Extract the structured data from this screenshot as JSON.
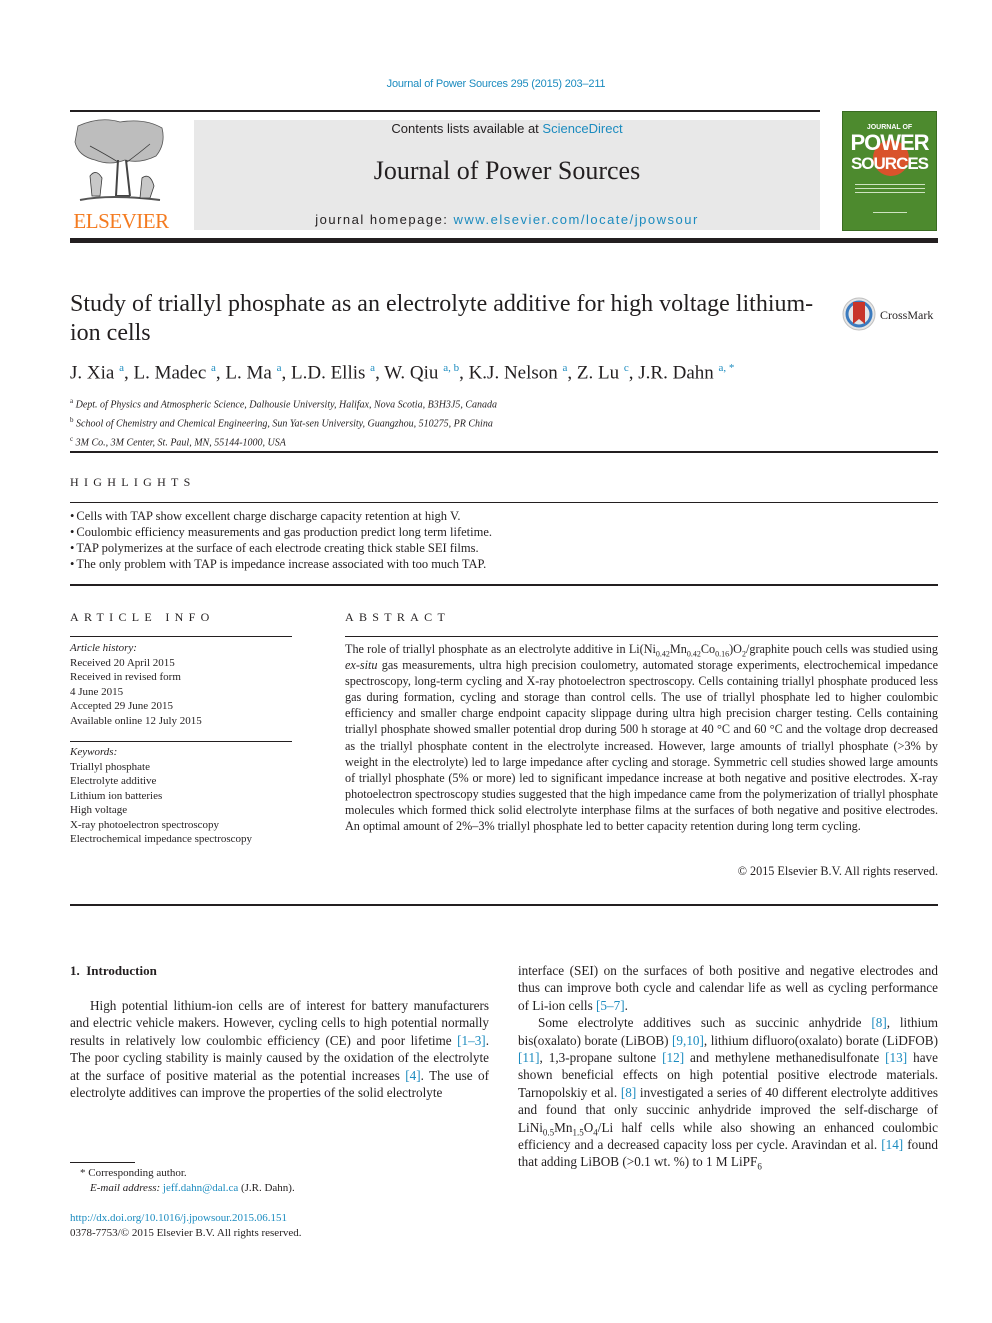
{
  "running_head": "Journal of Power Sources 295 (2015) 203–211",
  "masthead": {
    "publisher_logo_text": "ELSEVIER",
    "contents_prefix": "Contents lists available at ",
    "contents_link": "ScienceDirect",
    "journal_name": "Journal of Power Sources",
    "homepage_prefix": "journal homepage: ",
    "homepage_link": "www.elsevier.com/locate/jpowsour",
    "cover": {
      "line1": "JOURNAL OF",
      "line2": "POWER",
      "line3": "SOURCES"
    },
    "colors": {
      "link": "#1b8bbf",
      "elsevier_orange": "#f47b20",
      "cover_green": "#4d8a2e",
      "masthead_gray": "#e8e8e8"
    }
  },
  "article": {
    "title": "Study of triallyl phosphate as an electrolyte additive for high voltage lithium-ion cells",
    "crossmark_label": "CrossMark",
    "authors": [
      {
        "name": "J. Xia",
        "aff": "a"
      },
      {
        "name": "L. Madec",
        "aff": "a"
      },
      {
        "name": "L. Ma",
        "aff": "a"
      },
      {
        "name": "L.D. Ellis",
        "aff": "a"
      },
      {
        "name": "W. Qiu",
        "aff": "a, b"
      },
      {
        "name": "K.J. Nelson",
        "aff": "a"
      },
      {
        "name": "Z. Lu",
        "aff": "c"
      },
      {
        "name": "J.R. Dahn",
        "aff": "a, *"
      }
    ],
    "affiliations": [
      {
        "key": "a",
        "text": "Dept. of Physics and Atmospheric Science, Dalhousie University, Halifax, Nova Scotia, B3H3J5, Canada"
      },
      {
        "key": "b",
        "text": "School of Chemistry and Chemical Engineering, Sun Yat-sen University, Guangzhou, 510275, PR China"
      },
      {
        "key": "c",
        "text": "3M Co., 3M Center, St. Paul, MN, 55144-1000, USA"
      }
    ]
  },
  "highlights": {
    "label": "HIGHLIGHTS",
    "items": [
      "Cells with TAP show excellent charge discharge capacity retention at high V.",
      "Coulombic efficiency measurements and gas production predict long term lifetime.",
      "TAP polymerizes at the surface of each electrode creating thick stable SEI films.",
      "The only problem with TAP is impedance increase associated with too much TAP."
    ]
  },
  "article_info": {
    "label": "ARTICLE INFO",
    "history_label": "Article history:",
    "history": [
      "Received 20 April 2015",
      "Received in revised form",
      "4 June 2015",
      "Accepted 29 June 2015",
      "Available online 12 July 2015"
    ],
    "keywords_label": "Keywords:",
    "keywords": [
      "Triallyl phosphate",
      "Electrolyte additive",
      "Lithium ion batteries",
      "High voltage",
      "X-ray photoelectron spectroscopy",
      "Electrochemical impedance spectroscopy"
    ]
  },
  "abstract": {
    "label": "ABSTRACT",
    "p1": "The role of triallyl phosphate as an electrolyte additive in Li(Ni",
    "s1": "0.42",
    "p2": "Mn",
    "s2": "0.42",
    "p3": "Co",
    "s3": "0.16",
    "p4": ")O",
    "s4": "2",
    "p5": "/graphite pouch cells was studied using ",
    "ital": "ex-situ",
    "p6": " gas measurements, ultra high precision coulometry, automated storage experiments, electrochemical impedance spectroscopy, long-term cycling and X-ray photoelectron spectroscopy. Cells containing triallyl phosphate produced less gas during formation, cycling and storage than control cells. The use of triallyl phosphate led to higher coulombic efficiency and smaller charge endpoint capacity slippage during ultra high precision charger testing. Cells containing triallyl phosphate showed smaller potential drop during 500 h storage at 40 °C and 60 °C and the voltage drop decreased as the triallyl phosphate content in the electrolyte increased. However, large amounts of triallyl phosphate (>3% by weight in the electrolyte) led to large impedance after cycling and storage. Symmetric cell studies showed large amounts of triallyl phosphate (5% or more) led to significant impedance increase at both negative and positive electrodes. X-ray photoelectron spectroscopy studies suggested that the high impedance came from the polymerization of triallyl phosphate molecules which formed thick solid electrolyte interphase films at the surfaces of both negative and positive electrodes. An optimal amount of 2%–3% triallyl phosphate led to better capacity retention during long term cycling.",
    "copyright": "© 2015 Elsevier B.V. All rights reserved."
  },
  "introduction": {
    "heading": "1. Introduction",
    "left": {
      "t1": "High potential lithium-ion cells are of interest for battery manufacturers and electric vehicle makers. However, cycling cells to high potential normally results in relatively low coulombic efficiency (CE) and poor lifetime ",
      "r1": "[1–3]",
      "t2": ". The poor cycling stability is mainly caused by the oxidation of the electrolyte at the surface of positive material as the potential increases ",
      "r2": "[4]",
      "t3": ". The use of electrolyte additives can improve the properties of the solid electrolyte"
    },
    "right": {
      "t1": "interface (SEI) on the surfaces of both positive and negative electrodes and thus can improve both cycle and calendar life as well as cycling performance of Li-ion cells ",
      "r1": "[5–7]",
      "t2": ".",
      "t3": "Some electrolyte additives such as succinic anhydride ",
      "r2": "[8]",
      "t4": ", lithium bis(oxalato) borate (LiBOB) ",
      "r3": "[9,10]",
      "t5": ", lithium difluoro(oxalato) borate (LiDFOB) ",
      "r4": "[11]",
      "t6": ", 1,3-propane sultone ",
      "r5": "[12]",
      "t7": " and methylene methanedisulfonate ",
      "r6": "[13]",
      "t8": " have shown beneficial effects on high potential positive electrode materials. Tarnopolskiy et al. ",
      "r7": "[8]",
      "t9": " investigated a series of 40 different electrolyte additives and found that only succinic anhydride improved the self-discharge of LiNi",
      "s1": "0.5",
      "t10": "Mn",
      "s2": "1.5",
      "t11": "O",
      "s3": "4",
      "t12": "/Li half cells while also showing an enhanced coulombic efficiency and a decreased capacity loss per cycle. Aravindan et al. ",
      "r8": "[14]",
      "t13": " found that adding LiBOB (>0.1 wt. %) to 1 M LiPF",
      "s4": "6"
    }
  },
  "footnotes": {
    "corresponding": "* Corresponding author.",
    "email_label": "E-mail address: ",
    "email": "jeff.dahn@dal.ca",
    "email_suffix": " (J.R. Dahn).",
    "doi": "http://dx.doi.org/10.1016/j.jpowsour.2015.06.151",
    "issn_line": "0378-7753/© 2015 Elsevier B.V. All rights reserved."
  }
}
